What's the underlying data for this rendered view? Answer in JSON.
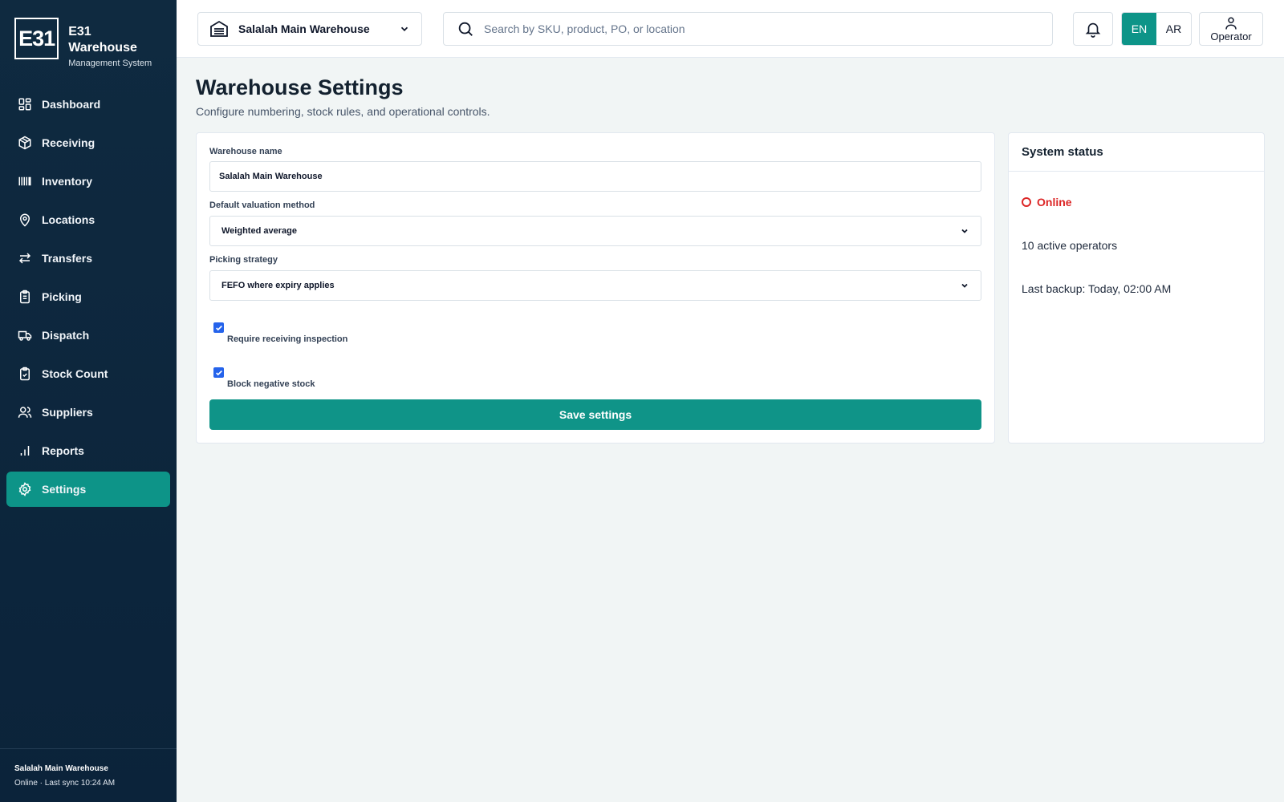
{
  "brand": {
    "logo": "E31",
    "title": "E31 Warehouse",
    "subtitle": "Management System"
  },
  "nav": [
    {
      "label": "Dashboard",
      "icon": "grid-icon"
    },
    {
      "label": "Receiving",
      "icon": "box-icon"
    },
    {
      "label": "Inventory",
      "icon": "barcode-icon"
    },
    {
      "label": "Locations",
      "icon": "map-pin-icon"
    },
    {
      "label": "Transfers",
      "icon": "arrows-icon"
    },
    {
      "label": "Picking",
      "icon": "clipboard-icon"
    },
    {
      "label": "Dispatch",
      "icon": "truck-icon"
    },
    {
      "label": "Stock Count",
      "icon": "clipboard-check-icon"
    },
    {
      "label": "Suppliers",
      "icon": "users-icon"
    },
    {
      "label": "Reports",
      "icon": "bar-chart-icon"
    },
    {
      "label": "Settings",
      "icon": "gear-icon",
      "active": true
    }
  ],
  "sidebar_footer": {
    "name": "Salalah Main Warehouse",
    "status": "Online · Last sync 10:24 AM"
  },
  "topbar": {
    "warehouse": "Salalah Main Warehouse",
    "search_placeholder": "Search by SKU, product, PO, or location",
    "lang_en": "EN",
    "lang_ar": "AR",
    "user": "Operator"
  },
  "page": {
    "title": "Warehouse Settings",
    "subtitle": "Configure numbering, stock rules, and operational controls."
  },
  "form": {
    "name_label": "Warehouse name",
    "name_value": "Salalah Main Warehouse",
    "valuation_label": "Default valuation method",
    "valuation_value": "Weighted average",
    "picking_label": "Picking strategy",
    "picking_value": "FEFO where expiry applies",
    "inspection_label": "Require receiving inspection",
    "inspection_checked": true,
    "negative_label": "Block negative stock",
    "negative_checked": true,
    "save_label": "Save settings"
  },
  "status": {
    "title": "System status",
    "online": "Online",
    "operators": "10 active operators",
    "backup": "Last backup: Today, 02:00 AM"
  },
  "colors": {
    "accent": "#0d9488",
    "sidebar": "#0f2a40",
    "online": "#dc2626",
    "checkbox": "#2563eb"
  }
}
